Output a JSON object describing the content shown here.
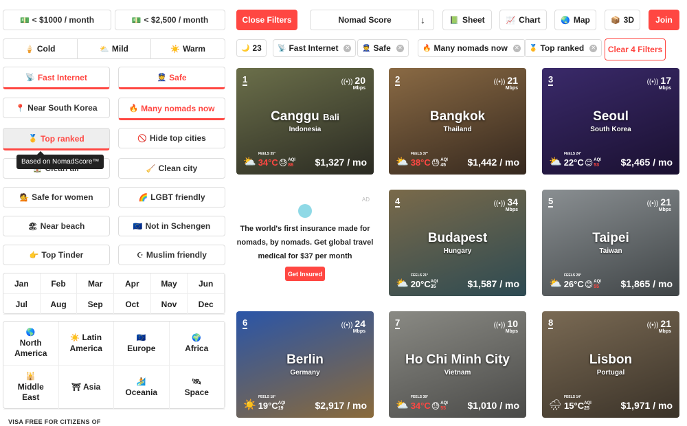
{
  "filters": {
    "budget": [
      {
        "icon": "💵",
        "label": "< $1000 / month"
      },
      {
        "icon": "💵",
        "label": "< $2,500 / month"
      }
    ],
    "climate": [
      {
        "icon": "🍦",
        "label": "Cold"
      },
      {
        "icon": "⛅",
        "label": "Mild"
      },
      {
        "icon": "☀️",
        "label": "Warm"
      }
    ],
    "toggles": [
      {
        "icon": "📡",
        "label": "Fast Internet"
      },
      {
        "icon": "👮",
        "label": "Safe"
      },
      {
        "icon": "📍",
        "label": "Near South Korea"
      },
      {
        "icon": "🔥",
        "label": "Many nomads now"
      },
      {
        "icon": "🥇",
        "label": "Top ranked"
      },
      {
        "icon": "🚫",
        "label": "Hide top cities"
      },
      {
        "icon": "🏠",
        "label": "Clean air"
      },
      {
        "icon": "🧹",
        "label": "Clean city"
      },
      {
        "icon": "💁",
        "label": "Safe for women"
      },
      {
        "icon": "🌈",
        "label": "LGBT friendly"
      },
      {
        "icon": "🏖",
        "label": "Near beach"
      },
      {
        "icon": "🇪🇺",
        "label": "Not in Schengen"
      },
      {
        "icon": "👉",
        "label": "Top Tinder"
      },
      {
        "icon": "☪",
        "label": "Muslim friendly"
      }
    ],
    "tooltip": "Based on NomadScore™",
    "months": [
      "Jan",
      "Feb",
      "Mar",
      "Apr",
      "May",
      "Jun",
      "Jul",
      "Aug",
      "Sep",
      "Oct",
      "Nov",
      "Dec"
    ],
    "regions": [
      {
        "icon": "🌎",
        "label": "North America"
      },
      {
        "icon": "☀️",
        "label": "Latin America"
      },
      {
        "icon": "🇪🇺",
        "label": "Europe"
      },
      {
        "icon": "🌍",
        "label": "Africa"
      },
      {
        "icon": "🕌",
        "label": "Middle East"
      },
      {
        "icon": "⛩",
        "label": "Asia"
      },
      {
        "icon": "🏄",
        "label": "Oceania"
      },
      {
        "icon": "🛰",
        "label": "Space"
      }
    ],
    "visa_heading": "VISA FREE FOR CITIZENS OF"
  },
  "toolbar": {
    "close_filters": "Close Filters",
    "sort_label": "Nomad Score",
    "sort_arrow": "↓",
    "views": [
      {
        "icon": "📗",
        "label": "Sheet"
      },
      {
        "icon": "📈",
        "label": "Chart"
      },
      {
        "icon": "🌏",
        "label": "Map"
      },
      {
        "icon": "📦",
        "label": "3D"
      }
    ],
    "join": "Join"
  },
  "active_filters": {
    "count_icon": "🌙",
    "count": "23",
    "chips": [
      {
        "icon": "📡",
        "label": "Fast Internet"
      },
      {
        "icon": "👮",
        "label": "Safe"
      },
      {
        "icon": "🔥",
        "label": "Many nomads now"
      },
      {
        "icon": "🥇",
        "label": "Top ranked"
      }
    ],
    "clear_label": "Clear 4 Filters"
  },
  "cities": [
    {
      "rank": "1",
      "name": "Canggu",
      "name_sub": "Bali",
      "country": "Indonesia",
      "mbps": "20",
      "feels": "FEELS 35°",
      "temp": "34°C",
      "aqi": "86",
      "price": "$1,327 / mo",
      "hot": true,
      "aqi_bad": true,
      "weather_icon": "⛅",
      "face_icon": "😓",
      "bg": "#6b6f4a",
      "bg2": "#2a2a22"
    },
    {
      "rank": "2",
      "name": "Bangkok",
      "name_sub": "",
      "country": "Thailand",
      "mbps": "21",
      "feels": "FEELS 37°",
      "temp": "38°C",
      "aqi": "45",
      "price": "$1,442 / mo",
      "hot": true,
      "aqi_bad": false,
      "weather_icon": "⛅",
      "face_icon": "😓",
      "bg": "#8a6a44",
      "bg2": "#35281e"
    },
    {
      "rank": "3",
      "name": "Seoul",
      "name_sub": "",
      "country": "South Korea",
      "mbps": "17",
      "feels": "FEELS 24°",
      "temp": "22°C",
      "aqi": "53",
      "price": "$2,465 / mo",
      "hot": false,
      "aqi_bad": true,
      "weather_icon": "⛅",
      "face_icon": "😊",
      "bg": "#3a2a6a",
      "bg2": "#1a1030"
    },
    {
      "rank": "4",
      "name": "Budapest",
      "name_sub": "",
      "country": "Hungary",
      "mbps": "34",
      "feels": "FEELS 21°",
      "temp": "20°C",
      "aqi": "35",
      "price": "$1,587 / mo",
      "hot": false,
      "aqi_bad": false,
      "weather_icon": "⛅",
      "face_icon": "",
      "bg": "#7a6a4a",
      "bg2": "#2d4a52"
    },
    {
      "rank": "5",
      "name": "Taipei",
      "name_sub": "",
      "country": "Taiwan",
      "mbps": "21",
      "feels": "FEELS 28°",
      "temp": "26°C",
      "aqi": "55",
      "price": "$1,865 / mo",
      "hot": false,
      "aqi_bad": true,
      "weather_icon": "⛅",
      "face_icon": "😊",
      "bg": "#8a8f92",
      "bg2": "#3f4446"
    },
    {
      "rank": "6",
      "name": "Berlin",
      "name_sub": "",
      "country": "Germany",
      "mbps": "24",
      "feels": "FEELS 18°",
      "temp": "19°C",
      "aqi": "19",
      "price": "$2,917 / mo",
      "hot": false,
      "aqi_bad": false,
      "weather_icon": "☀️",
      "face_icon": "",
      "bg": "#2a55a8",
      "bg2": "#8a6a3a"
    },
    {
      "rank": "7",
      "name": "Ho Chi Minh City",
      "name_sub": "",
      "country": "Vietnam",
      "mbps": "10",
      "feels": "FEELS 38°",
      "temp": "34°C",
      "aqi": "55",
      "price": "$1,010 / mo",
      "hot": true,
      "aqi_bad": true,
      "weather_icon": "⛅",
      "face_icon": "😓",
      "bg": "#8a8a84",
      "bg2": "#4a4a48"
    },
    {
      "rank": "8",
      "name": "Lisbon",
      "name_sub": "",
      "country": "Portugal",
      "mbps": "21",
      "feels": "FEELS 14°",
      "temp": "15°C",
      "aqi": "25",
      "price": "$1,971 / mo",
      "hot": false,
      "aqi_bad": false,
      "weather_icon": "🌧",
      "face_icon": "",
      "bg": "#7a6a54",
      "bg2": "#3a3228"
    }
  ],
  "ad": {
    "tag": "AD",
    "text": "The world's first insurance made for nomads, by nomads. Get global travel medical for $37 per month",
    "button": "Get Insured"
  },
  "colors": {
    "accent": "#ff4742",
    "border": "#dddddd"
  }
}
